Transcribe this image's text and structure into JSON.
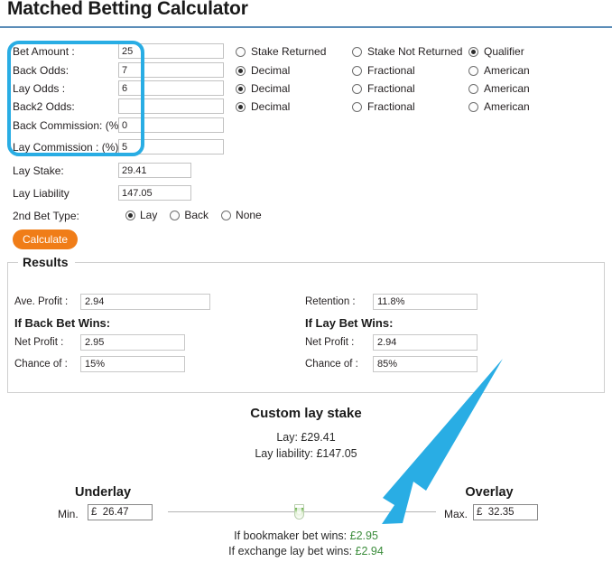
{
  "page": {
    "title": "Matched Betting Calculator",
    "accent_blue": "#29ade4",
    "rule_color": "#5b8db8",
    "button_orange": "#f07d18",
    "money_green": "#3b8c3b"
  },
  "form": {
    "rows": [
      {
        "label": "Bet Amount :",
        "value": "25"
      },
      {
        "label": "Back Odds:",
        "value": "7"
      },
      {
        "label": "Lay Odds :",
        "value": "6"
      },
      {
        "label": "Back2 Odds:",
        "value": ""
      },
      {
        "label": "Back Commission: (%)",
        "value": "0"
      },
      {
        "label": "Lay Commission : (%)",
        "value": "5"
      }
    ],
    "radio_rows": [
      {
        "options": [
          {
            "label": "Stake Returned",
            "selected": false
          },
          {
            "label": "Stake Not Returned",
            "selected": false
          },
          {
            "label": "Qualifier",
            "selected": true
          }
        ]
      },
      {
        "options": [
          {
            "label": "Decimal",
            "selected": true
          },
          {
            "label": "Fractional",
            "selected": false
          },
          {
            "label": "American",
            "selected": false
          }
        ]
      },
      {
        "options": [
          {
            "label": "Decimal",
            "selected": true
          },
          {
            "label": "Fractional",
            "selected": false
          },
          {
            "label": "American",
            "selected": false
          }
        ]
      },
      {
        "options": [
          {
            "label": "Decimal",
            "selected": true
          },
          {
            "label": "Fractional",
            "selected": false
          },
          {
            "label": "American",
            "selected": false
          }
        ]
      }
    ],
    "lay_stake": {
      "label": "Lay Stake:",
      "value": "29.41"
    },
    "lay_liability": {
      "label": "Lay Liability",
      "value": "147.05"
    },
    "second_bet_type": {
      "label": "2nd Bet Type:",
      "options": [
        {
          "label": "Lay",
          "selected": true
        },
        {
          "label": "Back",
          "selected": false
        },
        {
          "label": "None",
          "selected": false
        }
      ]
    },
    "calculate_label": "Calculate"
  },
  "results": {
    "legend": "Results",
    "left": {
      "avg_profit": {
        "label": "Ave. Profit :",
        "value": "2.94"
      },
      "heading": "If Back Bet Wins:",
      "net_profit": {
        "label": "Net Profit :",
        "value": "2.95"
      },
      "chance_of": {
        "label": "Chance of :",
        "value": "15%"
      }
    },
    "right": {
      "retention": {
        "label": "Retention :",
        "value": "11.8%"
      },
      "heading": "If Lay Bet Wins:",
      "net_profit": {
        "label": "Net Profit :",
        "value": "2.94"
      },
      "chance_of": {
        "label": "Chance of :",
        "value": "85%"
      }
    }
  },
  "custom": {
    "title": "Custom lay stake",
    "lay_line": "Lay: £29.41",
    "liability_line": "Lay liability: £147.05",
    "underlay_label": "Underlay",
    "overlay_label": "Overlay",
    "min_prefix": "Min.",
    "max_prefix": "Max.",
    "min_value": "£  26.47",
    "max_value": "£  32.35",
    "bookmaker_wins_label": "If bookmaker bet wins: ",
    "bookmaker_wins_value": "£2.95",
    "exchange_wins_label": "If exchange lay bet wins: ",
    "exchange_wins_value": "£2.94"
  }
}
